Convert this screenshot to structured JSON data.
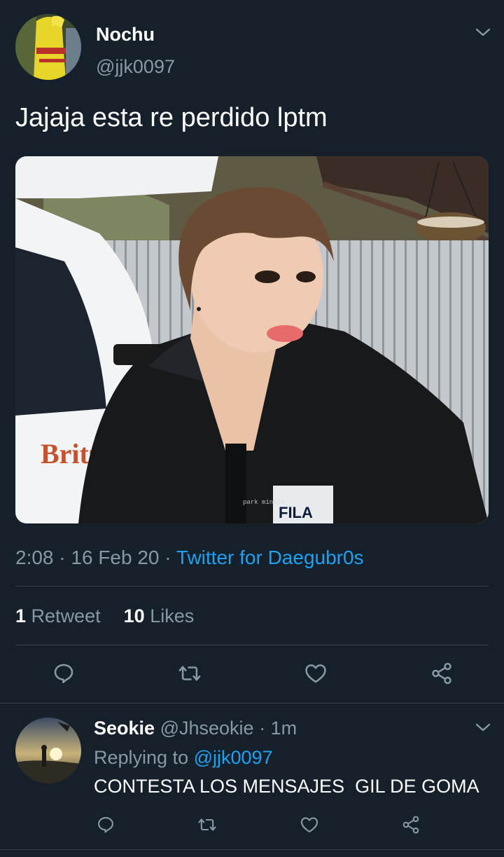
{
  "tweet": {
    "author_name": "Nochu",
    "author_handle": "@jjk0097",
    "text": "Jajaja esta re perdido lptm",
    "time": "2:08",
    "date": "16 Feb 20",
    "separator": "·",
    "source": "Twitter for Daegubr0s",
    "retweet_count": "1",
    "retweet_label": "Retweet",
    "like_count": "10",
    "like_label": "Likes",
    "media_caption": "park minmin",
    "media_signs": [
      "Britz",
      "FILA"
    ]
  },
  "reply": {
    "author_name": "Seokie",
    "author_handle": "@Jhseokie",
    "separator": "·",
    "time": "1m",
    "replying_label": "Replying to",
    "replying_handle": "@jjk0097",
    "text": "CONTESTA LOS MENSAJES  GIL DE GOMA"
  },
  "icons": {
    "more": "chevron-down-icon",
    "reply": "reply-icon",
    "retweet": "retweet-icon",
    "like": "heart-icon",
    "share": "share-icon"
  },
  "colors": {
    "background": "#15202b",
    "divider": "#38444d",
    "muted": "#8899a6",
    "link": "#1da1f2"
  }
}
